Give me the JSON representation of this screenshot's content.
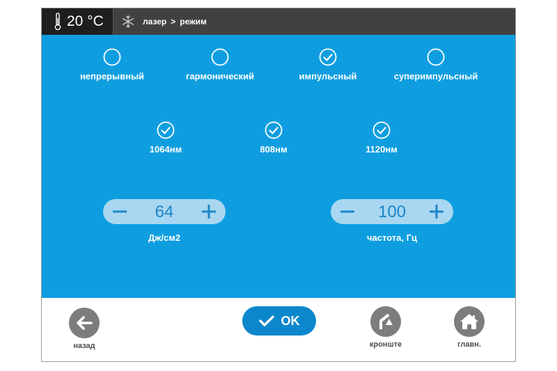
{
  "header": {
    "temperature": "20 °C",
    "breadcrumb": [
      "лазер",
      ">",
      "режим"
    ]
  },
  "modes": [
    {
      "label": "непрерывный",
      "checked": false
    },
    {
      "label": "гармонический",
      "checked": false
    },
    {
      "label": "импульсный",
      "checked": true
    },
    {
      "label": "суперимпульсный",
      "checked": false
    }
  ],
  "wavelengths": [
    {
      "label": "1064нм",
      "checked": true
    },
    {
      "label": "808нм",
      "checked": true
    },
    {
      "label": "1120нм",
      "checked": true
    }
  ],
  "energy": {
    "value": "64",
    "label": "Дж/см2"
  },
  "frequency": {
    "value": "100",
    "label": "частота, Гц"
  },
  "footer": {
    "back_label": "назад",
    "ok_label": "OK",
    "bracket_label": "кронште",
    "home_label": "главн."
  },
  "colors": {
    "header": "#414141",
    "panel": "#0e9ee0",
    "stepper_bg": "#a9d7f1",
    "ok_button": "#0c87cc",
    "footer_icon": "#7d7d7d"
  },
  "icons": {
    "temperature": "thermometer-icon",
    "mode": "snowflake-icon",
    "back": "arrow-left-icon",
    "ok": "checkmark-icon",
    "bracket": "bracket-arm-icon",
    "home": "house-icon"
  }
}
